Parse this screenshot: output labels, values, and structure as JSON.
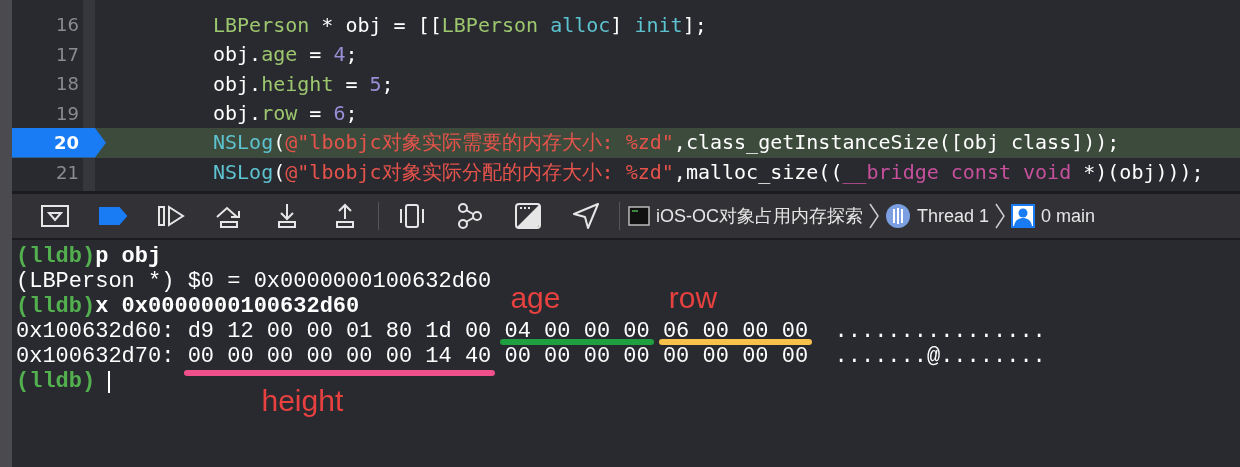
{
  "editor": {
    "lines": [
      {
        "number": "16",
        "current": false,
        "tokens": [
          {
            "kind": "type",
            "text": "LBPerson"
          },
          {
            "kind": "plain",
            "text": " * obj = [["
          },
          {
            "kind": "type",
            "text": "LBPerson"
          },
          {
            "kind": "method",
            "text": " alloc"
          },
          {
            "kind": "plain",
            "text": "] "
          },
          {
            "kind": "method",
            "text": "init"
          },
          {
            "kind": "plain",
            "text": "];"
          }
        ]
      },
      {
        "number": "17",
        "current": false,
        "tokens": [
          {
            "kind": "plain",
            "text": "obj."
          },
          {
            "kind": "prop",
            "text": "age"
          },
          {
            "kind": "plain",
            "text": " = "
          },
          {
            "kind": "num",
            "text": "4"
          },
          {
            "kind": "plain",
            "text": ";"
          }
        ]
      },
      {
        "number": "18",
        "current": false,
        "tokens": [
          {
            "kind": "plain",
            "text": "obj."
          },
          {
            "kind": "prop",
            "text": "height"
          },
          {
            "kind": "plain",
            "text": " = "
          },
          {
            "kind": "num",
            "text": "5"
          },
          {
            "kind": "plain",
            "text": ";"
          }
        ]
      },
      {
        "number": "19",
        "current": false,
        "tokens": [
          {
            "kind": "plain",
            "text": "obj."
          },
          {
            "kind": "prop",
            "text": "row"
          },
          {
            "kind": "plain",
            "text": " = "
          },
          {
            "kind": "num",
            "text": "6"
          },
          {
            "kind": "plain",
            "text": ";"
          }
        ]
      },
      {
        "number": "20",
        "current": true,
        "tokens": [
          {
            "kind": "method",
            "text": "NSLog"
          },
          {
            "kind": "plain",
            "text": "("
          },
          {
            "kind": "string",
            "text": "@\"lbobjc对象实际需要的内存大小: %zd\""
          },
          {
            "kind": "plain",
            "text": ",class_getInstanceSize([obj class]));"
          }
        ]
      },
      {
        "number": "21",
        "current": false,
        "tokens": [
          {
            "kind": "method",
            "text": "NSLog"
          },
          {
            "kind": "plain",
            "text": "("
          },
          {
            "kind": "string",
            "text": "@\"lbobjc对象实际分配的内存大小: %zd\""
          },
          {
            "kind": "plain",
            "text": ",malloc_size(("
          },
          {
            "kind": "keyword",
            "text": "__bridge const void"
          },
          {
            "kind": "plain",
            "text": " *)(obj)));"
          }
        ]
      }
    ]
  },
  "toolbar": {
    "breakpoints_active": true,
    "breadcrumbs": [
      {
        "kind": "app",
        "label": "iOS-OC对象占用内存探索"
      },
      {
        "kind": "thread",
        "label": "Thread 1"
      },
      {
        "kind": "frame",
        "label": "0 main"
      }
    ]
  },
  "console": {
    "lines": [
      {
        "kind": "prompt",
        "prompt": "(lldb)",
        "command": "p obj"
      },
      {
        "kind": "output",
        "text": "(LBPerson *) $0 = 0x0000000100632d60"
      },
      {
        "kind": "prompt",
        "prompt": "(lldb)",
        "command": "x 0x0000000100632d60"
      },
      {
        "kind": "memory",
        "address": "0x100632d60:",
        "bytes": "d9 12 00 00 01 80 1d 00 04 00 00 00 06 00 00 00",
        "ascii": "................"
      },
      {
        "kind": "memory",
        "address": "0x100632d70:",
        "bytes": "00 00 00 00 00 00 14 40 00 00 00 00 00 00 00 00",
        "ascii": ".......@........"
      },
      {
        "kind": "prompt",
        "prompt": "(lldb)"
      }
    ],
    "annotations": [
      {
        "label": "age",
        "color": "#1fa040"
      },
      {
        "label": "row",
        "color": "#f7c14a"
      },
      {
        "label": "height",
        "color": "#f0508a"
      }
    ]
  }
}
